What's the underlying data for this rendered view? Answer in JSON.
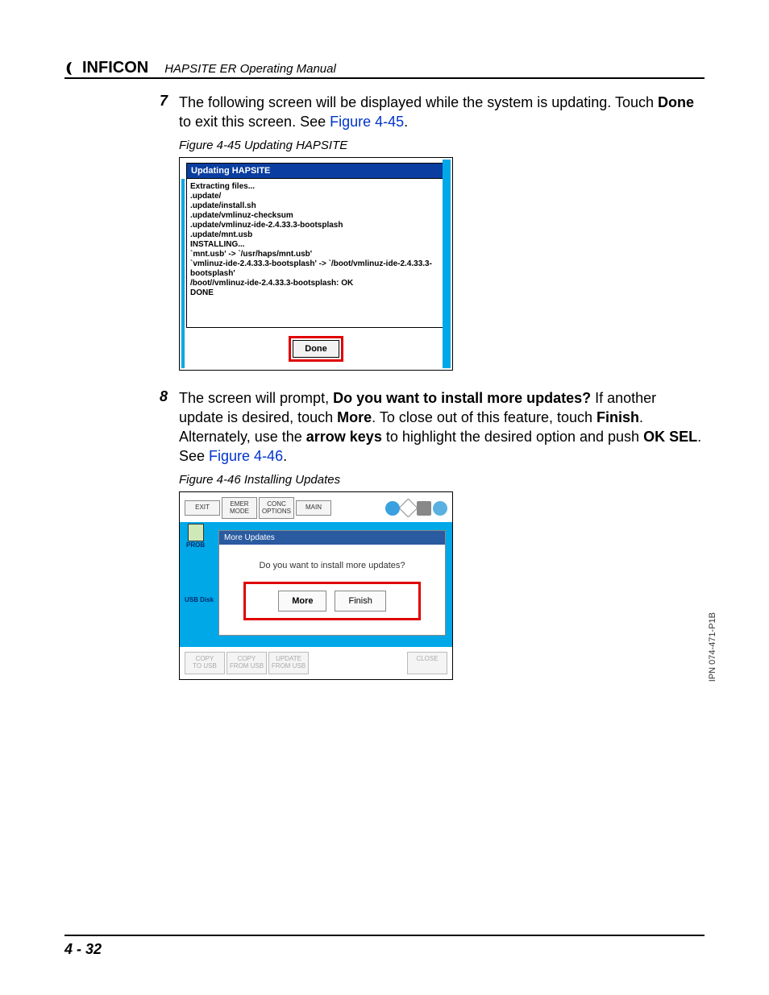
{
  "header": {
    "brand": "INFICON",
    "manual_title": "HAPSITE ER Operating Manual"
  },
  "steps": {
    "s7": {
      "num": "7",
      "text_a": "The following screen will be displayed while the system is updating. Touch ",
      "bold_a": "Done",
      "text_b": " to exit this screen. See ",
      "link": "Figure 4-45",
      "text_c": "."
    },
    "s8": {
      "num": "8",
      "text_a": "The screen will prompt, ",
      "bold_a": "Do you want to install more updates?",
      "text_b": " If another update is desired, touch ",
      "bold_b": "More",
      "text_c": ". To close out of this feature, touch ",
      "bold_c": "Finish",
      "text_d": ". Alternately, use the ",
      "bold_d": "arrow keys",
      "text_e": " to highlight the desired option and push ",
      "bold_e": "OK SEL",
      "text_f": ". See ",
      "link": "Figure 4-46",
      "text_g": "."
    }
  },
  "fig45": {
    "caption": "Figure 4-45  Updating HAPSITE",
    "title": "Updating HAPSITE",
    "log": "Extracting files...\n.update/\n.update/install.sh\n.update/vmlinuz-checksum\n.update/vmlinuz-ide-2.4.33.3-bootsplash\n.update/mnt.usb\nINSTALLING...\n`mnt.usb' -> `/usr/haps/mnt.usb'\n`vmlinuz-ide-2.4.33.3-bootsplash' -> `/boot/vmlinuz-ide-2.4.33.3-bootsplash'\n/boot//vmlinuz-ide-2.4.33.3-bootsplash: OK\nDONE",
    "done": "Done"
  },
  "fig46": {
    "caption": "Figure 4-46  Installing Updates",
    "top": {
      "exit": "EXIT",
      "emer": "EMER\nMODE",
      "conc": "CONC\nOPTIONS",
      "main": "MAIN"
    },
    "side": {
      "prob": "PROB",
      "usb": "USB Disk"
    },
    "dialog": {
      "title": "More Updates",
      "question": "Do you want to install more updates?",
      "more": "More",
      "finish": "Finish"
    },
    "bottom": {
      "copy_to": "COPY\nTO USB",
      "copy_from": "COPY\nFROM USB",
      "update_from": "UPDATE\nFROM USB",
      "close": "CLOSE"
    }
  },
  "ipn": "IPN 074-471-P1B",
  "page_number": "4 - 32"
}
